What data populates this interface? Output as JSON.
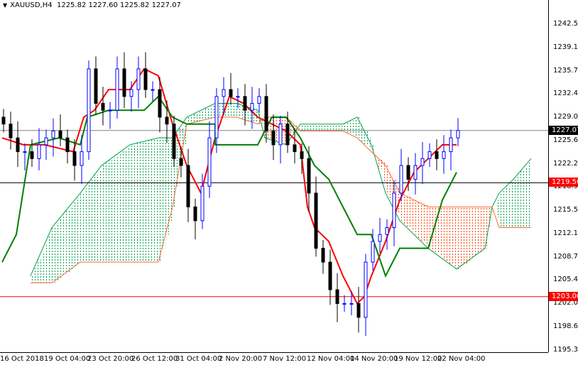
{
  "header": {
    "symbol": "XAUUSD,H4",
    "ohlc": "1225.82 1227.60 1225.82 1227.07"
  },
  "chart_data": {
    "type": "candlestick",
    "title": "XAUUSD,H4",
    "ylim": [
      1195.3,
      1245.0
    ],
    "y_ticks": [
      "1242.50",
      "1239.10",
      "1235.70",
      "1232.40",
      "1229.00",
      "1225.60",
      "1222.20",
      "1218.90",
      "1215.50",
      "1212.10",
      "1208.70",
      "1205.40",
      "1202.00",
      "1198.60",
      "1195.30"
    ],
    "x_ticks": [
      {
        "label": "16 Oct 2018",
        "bar": 0
      },
      {
        "label": "19 Oct 04:00",
        "bar": 6.2
      },
      {
        "label": "23 Oct 20:00",
        "bar": 12.3
      },
      {
        "label": "26 Oct 12:00",
        "bar": 18.5
      },
      {
        "label": "31 Oct 04:00",
        "bar": 24.7
      },
      {
        "label": "2 Nov 20:00",
        "bar": 30.8
      },
      {
        "label": "7 Nov 12:00",
        "bar": 37
      },
      {
        "label": "12 Nov 04:00",
        "bar": 43.2
      },
      {
        "label": "14 Nov 20:00",
        "bar": 49.3
      },
      {
        "label": "19 Nov 12:00",
        "bar": 55.5
      },
      {
        "label": "22 Nov 04:00",
        "bar": 61.6
      }
    ],
    "closes": [
      1228,
      1226,
      1224,
      1224,
      1223,
      1225,
      1226,
      1227,
      1226,
      1224,
      1222,
      1224,
      1236,
      1231,
      1230,
      1230,
      1236,
      1232,
      1233,
      1236,
      1233,
      1233,
      1229,
      1228,
      1223,
      1222,
      1216,
      1214,
      1219,
      1226,
      1232,
      1233,
      1232,
      1232,
      1230,
      1231,
      1232,
      1227,
      1225,
      1228,
      1225,
      1224,
      1223,
      1218,
      1210,
      1208,
      1204,
      1202,
      1202,
      1202,
      1200,
      1208,
      1211,
      1212,
      1213,
      1218,
      1222,
      1220,
      1222,
      1223,
      1224,
      1223,
      1224,
      1226,
      1227.07
    ],
    "tenkan": [
      [
        0,
        1226
      ],
      [
        3,
        1225
      ],
      [
        6,
        1225
      ],
      [
        10,
        1224
      ],
      [
        11.5,
        1229
      ],
      [
        13,
        1230
      ],
      [
        15,
        1233
      ],
      [
        18,
        1233
      ],
      [
        20,
        1236
      ],
      [
        22,
        1235
      ],
      [
        24,
        1228
      ],
      [
        26,
        1222
      ],
      [
        28,
        1218
      ],
      [
        30,
        1226
      ],
      [
        32,
        1232
      ],
      [
        34,
        1231
      ],
      [
        36,
        1229
      ],
      [
        38,
        1228
      ],
      [
        40,
        1227
      ],
      [
        42,
        1225
      ],
      [
        43,
        1216
      ],
      [
        44,
        1213
      ],
      [
        46,
        1211
      ],
      [
        48,
        1206
      ],
      [
        50,
        1202
      ],
      [
        51,
        1203
      ],
      [
        52,
        1206
      ],
      [
        54,
        1211
      ],
      [
        56,
        1217
      ],
      [
        58,
        1221
      ],
      [
        60,
        1223
      ],
      [
        62,
        1225
      ],
      [
        64,
        1225
      ]
    ],
    "kijun": [
      [
        0,
        1208
      ],
      [
        2,
        1212
      ],
      [
        4,
        1225
      ],
      [
        8,
        1226
      ],
      [
        11,
        1225
      ],
      [
        12,
        1229
      ],
      [
        15,
        1230
      ],
      [
        20,
        1230
      ],
      [
        22,
        1232
      ],
      [
        24,
        1229
      ],
      [
        26,
        1228
      ],
      [
        30,
        1228
      ],
      [
        30,
        1225
      ],
      [
        36,
        1225
      ],
      [
        38,
        1229
      ],
      [
        40,
        1229
      ],
      [
        42,
        1226
      ],
      [
        44,
        1222
      ],
      [
        46,
        1220
      ],
      [
        48,
        1216
      ],
      [
        50,
        1212
      ],
      [
        52,
        1212
      ],
      [
        54,
        1206
      ],
      [
        56,
        1210
      ],
      [
        60,
        1210
      ],
      [
        62,
        1217
      ],
      [
        64,
        1221
      ]
    ],
    "senkou_a": [
      [
        4,
        1206
      ],
      [
        7,
        1213
      ],
      [
        11,
        1218
      ],
      [
        14,
        1222
      ],
      [
        18,
        1225
      ],
      [
        22,
        1226
      ],
      [
        24,
        1226
      ],
      [
        26,
        1229
      ],
      [
        30,
        1231
      ],
      [
        33,
        1231
      ],
      [
        36,
        1230
      ],
      [
        37,
        1226
      ],
      [
        40,
        1225
      ],
      [
        42,
        1228
      ],
      [
        44,
        1228
      ],
      [
        48,
        1228
      ],
      [
        50,
        1229
      ],
      [
        52,
        1225
      ],
      [
        54,
        1218
      ],
      [
        56,
        1214
      ],
      [
        60,
        1210
      ],
      [
        64,
        1207
      ],
      [
        68,
        1210
      ],
      [
        69,
        1216
      ],
      [
        70,
        1218
      ],
      [
        72,
        1220
      ],
      [
        74.5,
        1223
      ]
    ],
    "senkou_b": [
      [
        4,
        1205
      ],
      [
        7,
        1205
      ],
      [
        11,
        1208
      ],
      [
        14,
        1208
      ],
      [
        18,
        1208
      ],
      [
        22,
        1208
      ],
      [
        24,
        1216
      ],
      [
        26,
        1228
      ],
      [
        30,
        1229
      ],
      [
        33,
        1229
      ],
      [
        36,
        1228
      ],
      [
        37,
        1229
      ],
      [
        40,
        1229
      ],
      [
        42,
        1227
      ],
      [
        44,
        1227
      ],
      [
        48,
        1227
      ],
      [
        50,
        1226
      ],
      [
        52,
        1224
      ],
      [
        54,
        1222
      ],
      [
        56,
        1218
      ],
      [
        60,
        1216
      ],
      [
        64,
        1216
      ],
      [
        68,
        1216
      ],
      [
        69,
        1216
      ],
      [
        70,
        1213
      ],
      [
        72,
        1213
      ],
      [
        74.5,
        1213
      ]
    ],
    "levels": [
      {
        "price": "1227.07",
        "color": "#808080",
        "tag_bg": "#000000"
      },
      {
        "price": "1219.50",
        "color": "#000000",
        "tag_bg": "#ff0000"
      },
      {
        "price": "1203.00",
        "color": "#ff0000",
        "tag_bg": "#ff0000"
      }
    ],
    "colors": {
      "bull": "#0000ff",
      "bear": "#000000",
      "tenkan": "#ff0000",
      "kijun": "#008000",
      "cloud_up": "#00a050",
      "cloud_down": "#ff4500"
    }
  }
}
